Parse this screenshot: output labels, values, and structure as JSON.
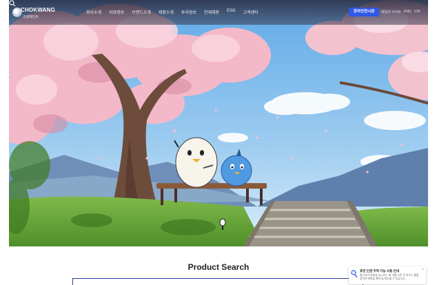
{
  "header": {
    "logo_text": "CHOKWANG",
    "logo_sub": "조광페인트",
    "nav": [
      "회사소개",
      "자료정보",
      "브랜드소개",
      "제품소개",
      "투자정보",
      "인재채용",
      "ESG",
      "고객센터"
    ],
    "cta_label": "온라인전시관",
    "utility_links": [
      "패밀리 사이트",
      "ENG",
      "CHI"
    ]
  },
  "product_search": {
    "title": "Product Search"
  },
  "notice": {
    "title": "휴먼 인권 추적 기능 사용 안내",
    "body": "웹 브라우저에서 Ctrl 또는 ⌘ 키를 누른 후 마우스 휠을 움직여 화면을 확대 및 축소할 수 있습니다."
  },
  "colors": {
    "cta": "#2f58e8",
    "search_border": "#2a3e9c"
  }
}
